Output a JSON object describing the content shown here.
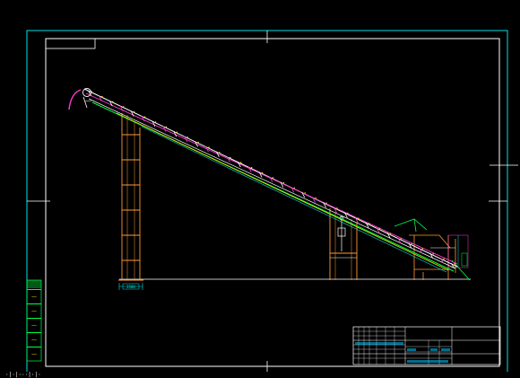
{
  "colors": {
    "background": "#000000",
    "frame": "#00e5e5",
    "border": "#ffffff",
    "belt": "#ffffff",
    "belt_accent": "#ff3bd4",
    "return_line": "#00ff44",
    "under_line": "#e8e800",
    "support": "#ff9a33",
    "dimension": "#00e5e5",
    "label_box": "#00ff44",
    "label_text": "#ffe000",
    "titleblock": "#ffffff",
    "titleblock_fill": "#00c8ff"
  },
  "drawing": {
    "type": "inclined belt conveyor side elevation",
    "dimension_labels": {
      "support_base_width": "3500"
    }
  },
  "left_labels": [
    "—",
    "—",
    "—",
    "—",
    "—"
  ],
  "title_block": {
    "cells": [
      "",
      "",
      "",
      "",
      "",
      ""
    ]
  },
  "status_bar": {
    "text": "·|·|···|·|·"
  }
}
